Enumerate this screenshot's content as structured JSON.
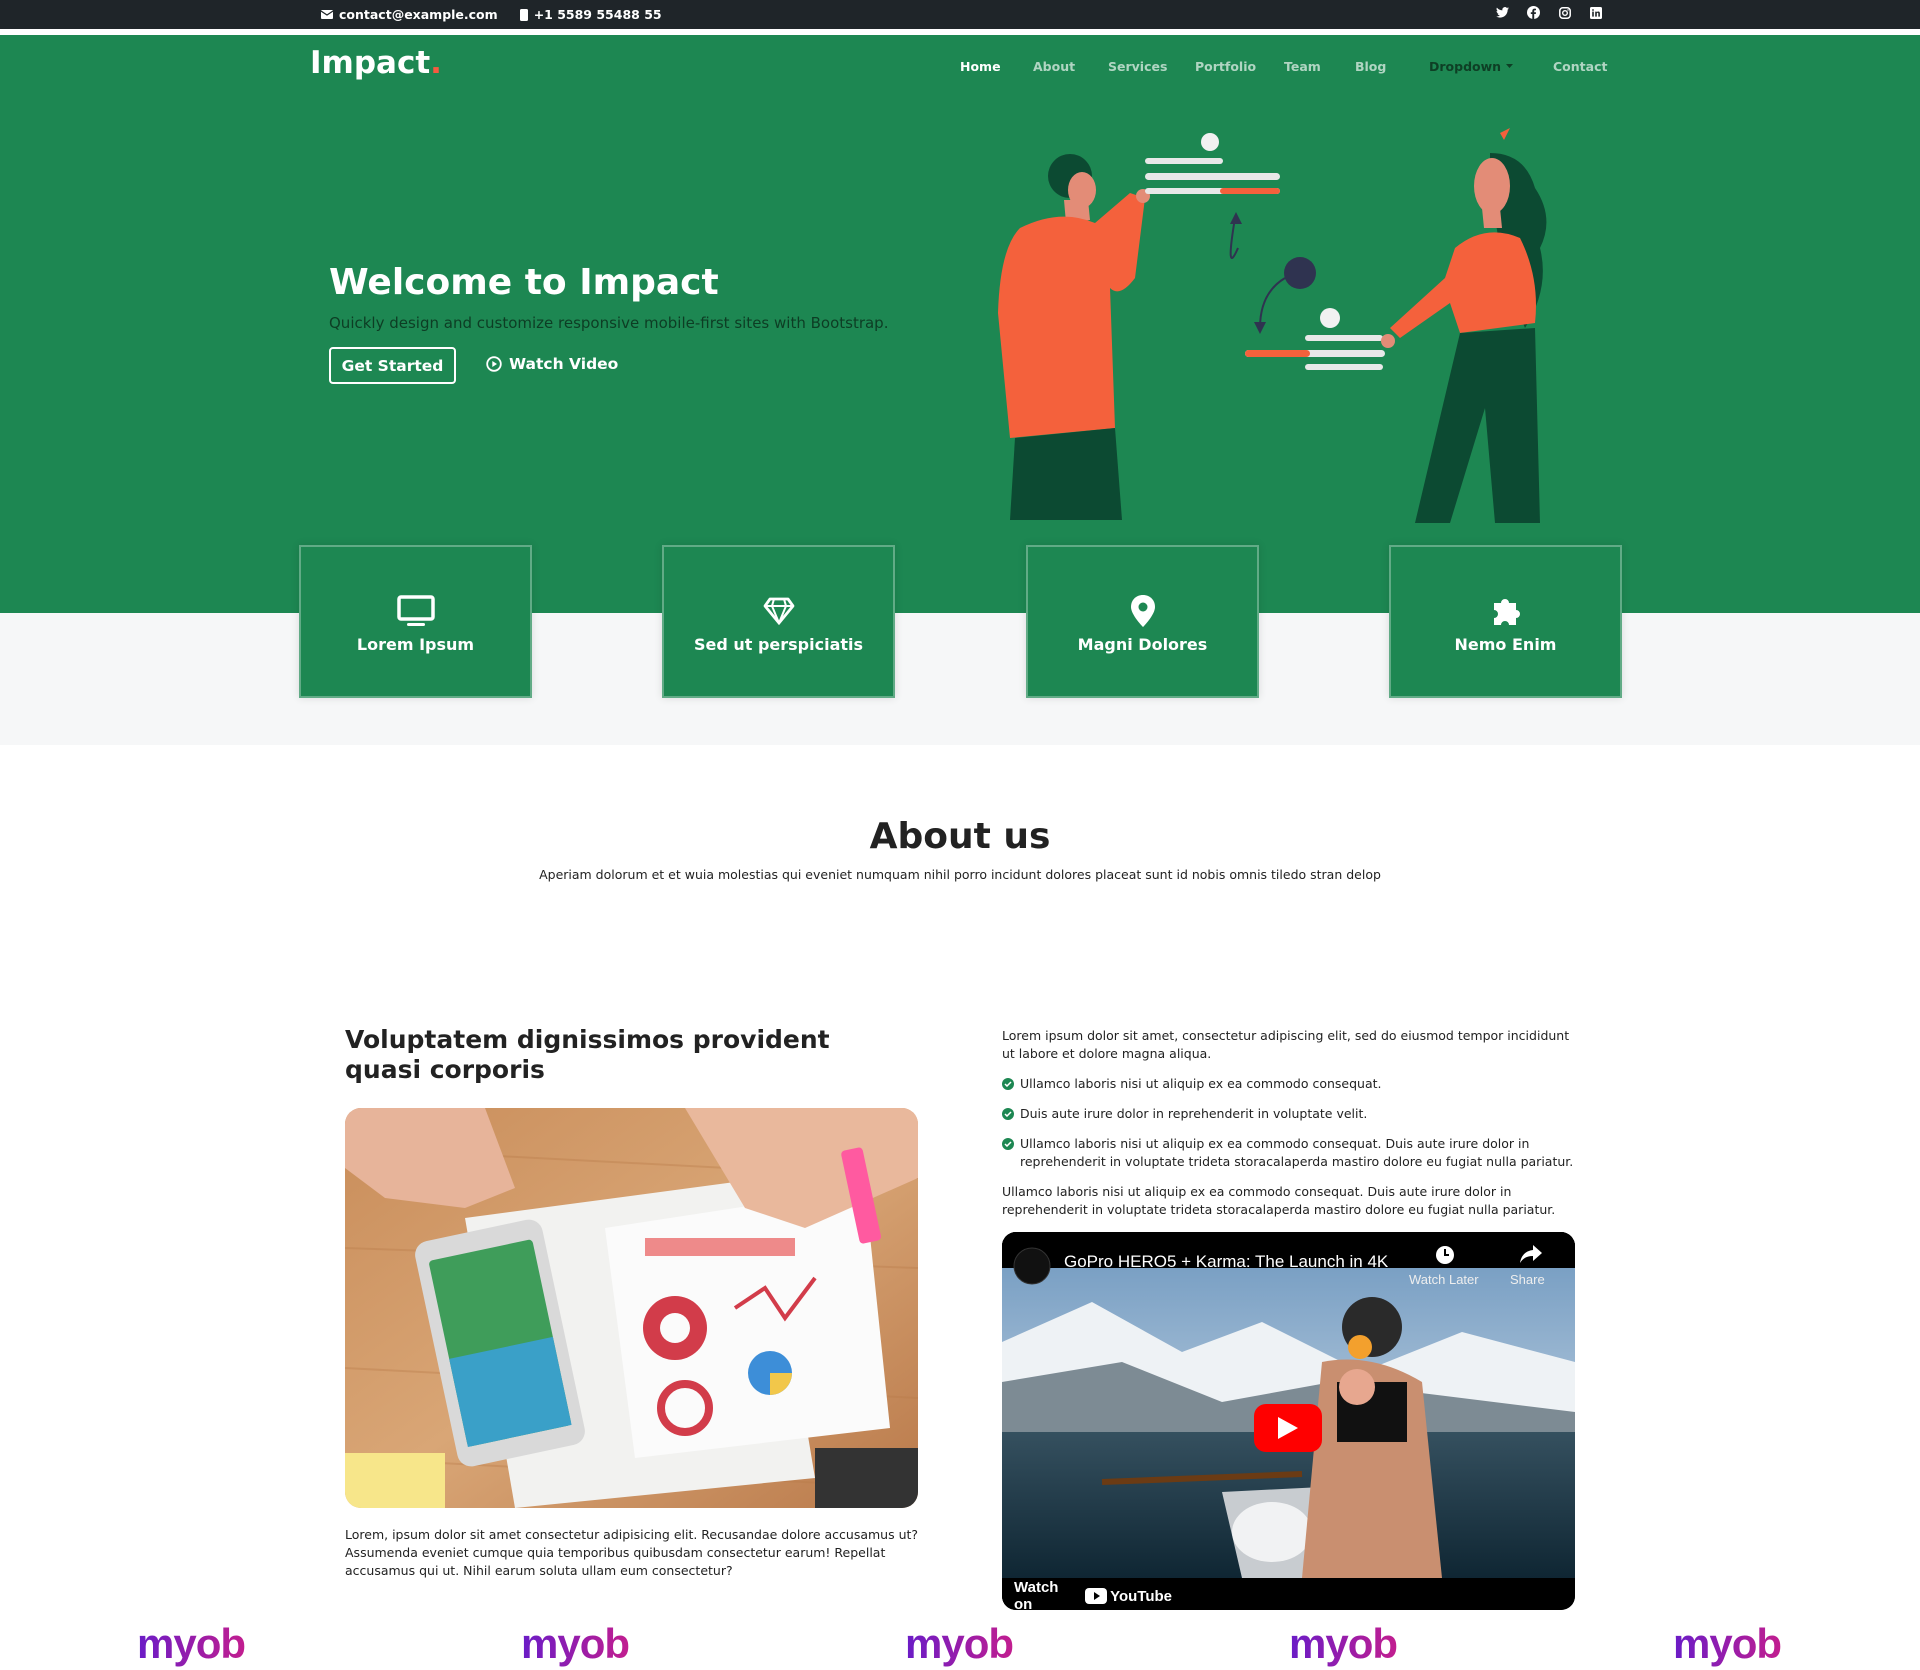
{
  "topbar": {
    "email": "contact@example.com",
    "phone": "+1 5589 55488 55",
    "social": [
      "twitter-icon",
      "facebook-icon",
      "instagram-icon",
      "linkedin-icon"
    ]
  },
  "brand": {
    "name": "Impact",
    "dot": ".",
    "accent": "#f85a40",
    "primary": "#1d8752"
  },
  "nav": {
    "home": "Home",
    "about": "About",
    "services": "Services",
    "portfolio": "Portfolio",
    "team": "Team",
    "blog": "Blog",
    "dropdown": "Dropdown",
    "contact": "Contact"
  },
  "hero": {
    "title": "Welcome to Impact",
    "subtitle": "Quickly design and customize responsive mobile-first sites with Bootstrap.",
    "cta": "Get Started",
    "video": "Watch Video"
  },
  "cards": [
    {
      "label": "Lorem Ipsum",
      "icon": "monitor-icon"
    },
    {
      "label": "Sed ut perspiciatis",
      "icon": "gem-icon"
    },
    {
      "label": "Magni Dolores",
      "icon": "map-pin-icon"
    },
    {
      "label": "Nemo Enim",
      "icon": "puzzle-icon"
    }
  ],
  "about": {
    "title": "About us",
    "subtitle": "Aperiam dolorum et et wuia molestias qui eveniet numquam nihil porro incidunt dolores placeat sunt id nobis omnis tiledo stran delop",
    "left_heading": "Voluptatem dignissimos provident quasi corporis",
    "left_text": "Lorem, ipsum dolor sit amet consectetur adipisicing elit. Recusandae dolore accusamus ut? Assumenda eveniet cumque quia temporibus quibusdam consectetur earum! Repellat accusamus qui ut. Nihil earum soluta ullam eum consectetur?",
    "right_intro": "Lorem ipsum dolor sit amet, consectetur adipiscing elit, sed do eiusmod tempor incididunt ut labore et dolore magna aliqua.",
    "checks": [
      "Ullamco laboris nisi ut aliquip ex ea commodo consequat.",
      "Duis aute irure dolor in reprehenderit in voluptate velit.",
      "Ullamco laboris nisi ut aliquip ex ea commodo consequat. Duis aute irure dolor in reprehenderit in voluptate trideta storacalaperda mastiro dolore eu fugiat nulla pariatur."
    ],
    "right_outro": "Ullamco laboris nisi ut aliquip ex ea commodo consequat. Duis aute irure dolor in reprehenderit in voluptate trideta storacalaperda mastiro dolore eu fugiat nulla pariatur."
  },
  "video": {
    "title": "GoPro HERO5 + Karma: The Launch in 4K",
    "watch_later": "Watch Later",
    "share": "Share",
    "watch_on": "Watch on",
    "youtube": "YouTube"
  },
  "client_logos": [
    "myob",
    "myob",
    "myob",
    "myob",
    "myob"
  ]
}
